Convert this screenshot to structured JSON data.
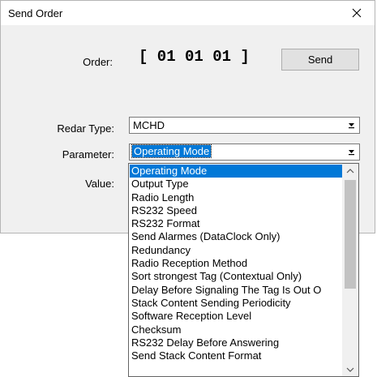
{
  "dialog": {
    "title": "Send Order",
    "close_icon": "close-icon"
  },
  "order": {
    "label": "Order:",
    "value": "[ 01 01 01 ]",
    "send_label": "Send"
  },
  "reader_type": {
    "label": "Redar Type:",
    "value": "MCHD"
  },
  "parameter": {
    "label": "Parameter:",
    "value": "Operating Mode",
    "options": [
      "Operating Mode",
      "Output Type",
      "Radio Length",
      "RS232 Speed",
      "RS232 Format",
      "Send Alarmes (DataClock Only)",
      "Redundancy",
      "Radio Reception Method",
      "Sort strongest Tag (Contextual Only)",
      "Delay Before Signaling The Tag Is Out O",
      "Stack Content Sending Periodicity",
      "Software Reception Level",
      "Checksum",
      "RS232 Delay Before Answering",
      "Send Stack Content Format"
    ],
    "selected_index": 0
  },
  "value": {
    "label": "Value:"
  },
  "colors": {
    "selection": "#0078d7",
    "dialog_bg": "#f0f0f0"
  }
}
